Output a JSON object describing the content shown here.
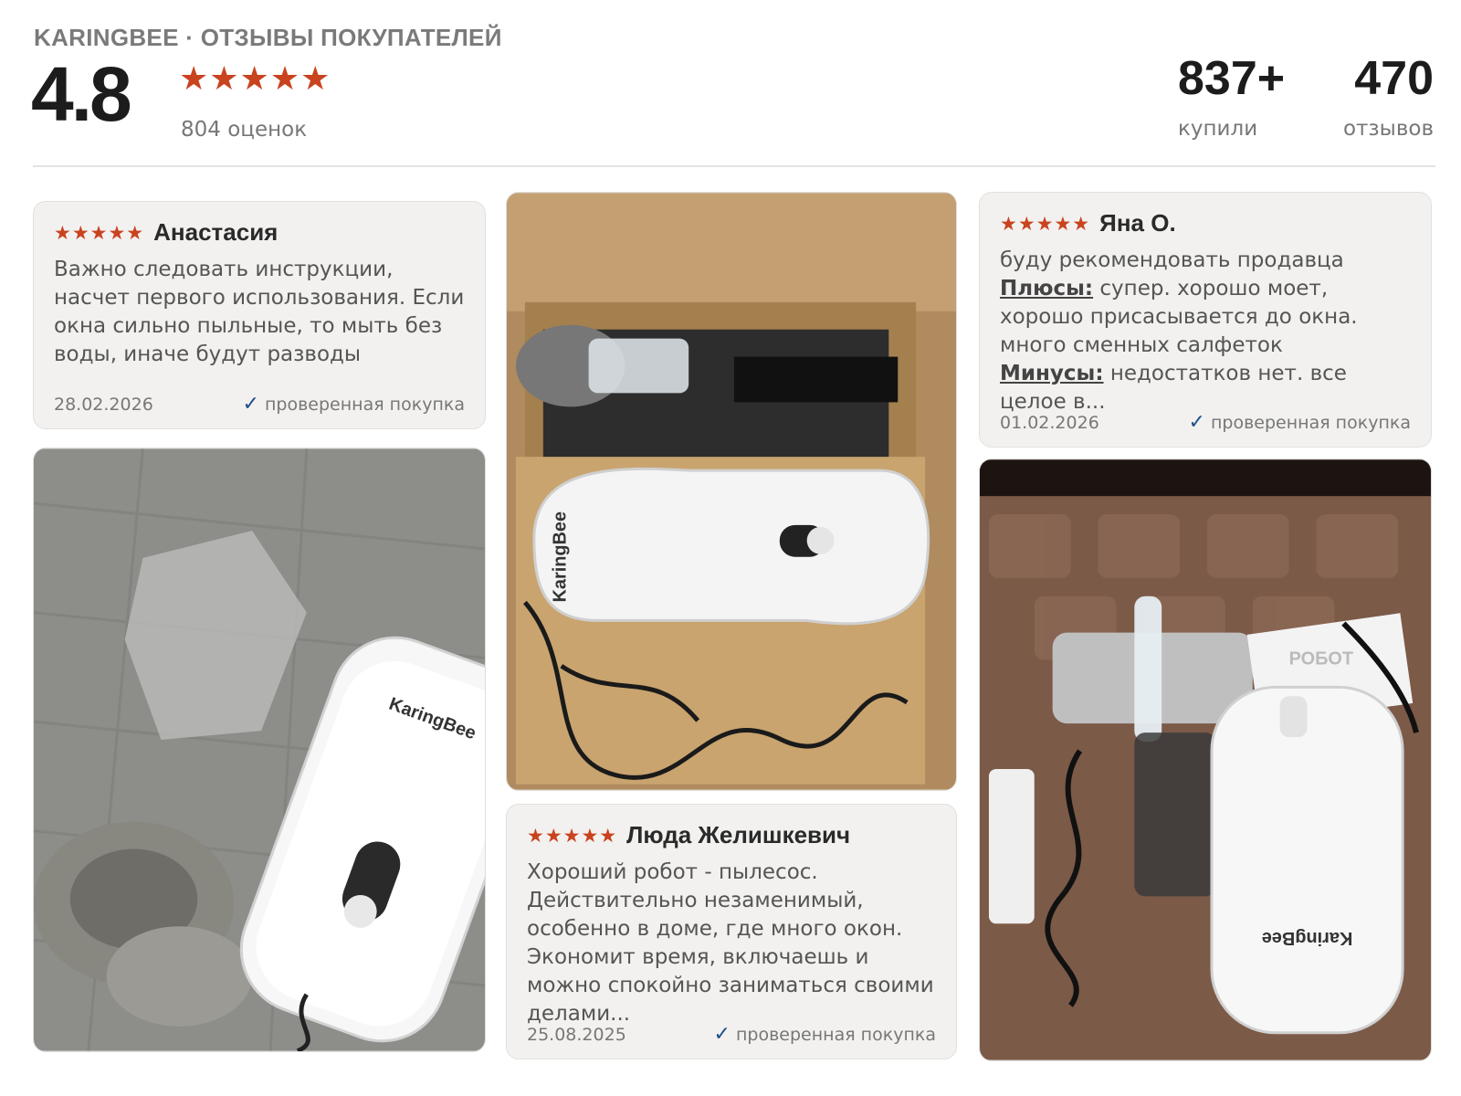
{
  "header": {
    "brand_title": "KARINGBEE · ОТЗЫВЫ ПОКУПАТЕЛЕЙ",
    "rating": "4.8",
    "stars": "★★★★★",
    "rating_count": "804 оценок",
    "bought_num": "837+",
    "bought_label": "купили",
    "reviews_num": "470",
    "reviews_label": "отзывов"
  },
  "photo_text": {
    "brand_logo": "KaringBee",
    "box_label": "РОБОТ"
  },
  "reviews": [
    {
      "stars": "★★★★★",
      "author": "Анастасия",
      "text": "Важно следовать инструкции, насчет первого использования. Если окна сильно пыльные, то мыть без воды, иначе будут разводы",
      "date": "28.02.2026",
      "verified": "проверенная покупка"
    },
    {
      "stars": "★★★★★",
      "author": "Люда Желишкевич",
      "text": "Хороший робот - пылесос. Действительно незаменимый, особенно в доме, где много окон. Экономит время, включаешь и можно спокойно заниматься своими делами...",
      "date": "25.08.2025",
      "verified": "проверенная покупка"
    },
    {
      "stars": "★★★★★",
      "author": "Яна О.",
      "intro": "буду рекомендовать продавца",
      "pros_label": "Плюсы:",
      "pros": "супер. хорошо моет, хорошо присасывается до окна. много сменных салфеток",
      "cons_label": "Минусы:",
      "cons": "недостатков нет. все целое в...",
      "date": "01.02.2026",
      "verified": "проверенная покупка"
    }
  ],
  "colors": {
    "star": "#c9431f",
    "check": "#1d4e89",
    "card_bg": "#f2f1ef"
  },
  "icons": [
    "star-icon",
    "checkmark-icon"
  ]
}
